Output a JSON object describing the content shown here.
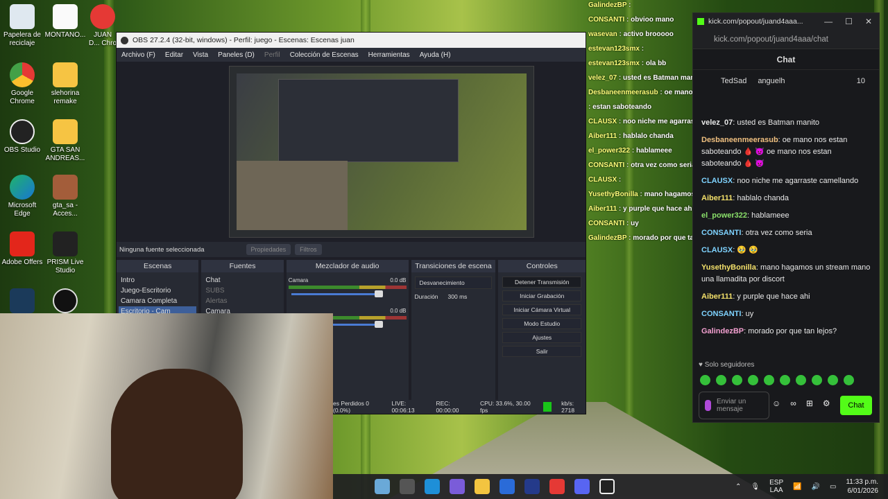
{
  "desktop": {
    "icons": [
      {
        "label": "Papelera de reciclaje"
      },
      {
        "label": "MONTANO..."
      },
      {
        "label": "JUAN D...\nChro"
      },
      {
        "label": "Google Chrome"
      },
      {
        "label": "slehorina remake"
      },
      {
        "label": "OBS Studio"
      },
      {
        "label": "GTA SAN ANDREAS..."
      },
      {
        "label": "Microsoft Edge"
      },
      {
        "label": "gta_sa - Acces..."
      },
      {
        "label": "Adobe Offers"
      },
      {
        "label": "PRISM Live Studio"
      }
    ]
  },
  "obs": {
    "title": "OBS 27.2.4 (32-bit, windows) - Perfil: juego - Escenas: Escenas juan",
    "menu": [
      "Archivo (F)",
      "Editar",
      "Vista",
      "Paneles (D)",
      "Perfil",
      "Colección de Escenas",
      "Herramientas",
      "Ayuda (H)"
    ],
    "no_source": "Ninguna fuente seleccionada",
    "properties_btn": "Propiedades",
    "filters_btn": "Filtros",
    "scenes": {
      "title": "Escenas",
      "items": [
        "Intro",
        "Juego-Escritorio",
        "Camara Completa",
        "Escritorio - Cam"
      ]
    },
    "sources": {
      "title": "Fuentes",
      "items": [
        "Chat",
        "SUBS",
        "Alertas",
        "Camara"
      ]
    },
    "mixer": {
      "title": "Mezclador de audio",
      "tracks": [
        {
          "name": "Camara",
          "db": "0.0 dB"
        },
        {
          "name": "",
          "db": "0.0 dB"
        }
      ]
    },
    "transitions": {
      "title": "Transiciones de escena",
      "type": "Desvanecimiento",
      "duration_label": "Duración",
      "duration": "300 ms"
    },
    "controls": {
      "title": "Controles",
      "buttons": [
        "Detener Transmisión",
        "Iniciar Grabación",
        "Iniciar Cámara Virtual",
        "Modo Estudio",
        "Ajustes",
        "Salir"
      ]
    },
    "status": {
      "dropped": "es Perdidos 0 (0.0%)",
      "live": "LIVE: 00:06:13",
      "rec": "REC: 00:00:00",
      "cpu": "CPU: 33.6%, 30.00 fps",
      "kbs": "kb/s: 2718"
    }
  },
  "overlay_chat": [
    {
      "user": "GalindezBP",
      "text": ""
    },
    {
      "user": "CONSANTI",
      "text": "obvioo mano"
    },
    {
      "user": "wasevan",
      "text": "activo brooooo"
    },
    {
      "user": "estevan123smx",
      "text": ""
    },
    {
      "user": "estevan123smx",
      "text": "ola bb"
    },
    {
      "user": "velez_07",
      "text": "usted es Batman manito"
    },
    {
      "user": "Desbaneenmeerasub",
      "text": "oe mano nos estan saboteando"
    },
    {
      "user": "",
      "text": "estan saboteando"
    },
    {
      "user": "CLAUSX",
      "text": "noo niche me agarraste camellando"
    },
    {
      "user": "Aiber111",
      "text": "hablalo chanda"
    },
    {
      "user": "el_power322",
      "text": "hablameee"
    },
    {
      "user": "CONSANTI",
      "text": "otra vez como seria"
    },
    {
      "user": "CLAUSX",
      "text": ""
    },
    {
      "user": "YusethyBonilla",
      "text": "mano hagamos un stream mano una llamadita por discort"
    },
    {
      "user": "Aiber111",
      "text": "y purple que hace ahi"
    },
    {
      "user": "CONSANTI",
      "text": "uy"
    },
    {
      "user": "GalindezBP",
      "text": "morado por que tan lejos?"
    }
  ],
  "kick": {
    "tab_title": "kick.com/popout/juand4aaa...",
    "url": "kick.com/popout/juand4aaa/chat",
    "header": "Chat",
    "pinned": {
      "user1": "TedSad",
      "user2": "anguelh",
      "count": "10"
    },
    "messages": [
      {
        "user": "velez_07",
        "text": "usted es Batman manito",
        "color": "#e8e8e8"
      },
      {
        "user": "Desbaneenmeerasub",
        "text": "oe mano nos estan saboteando 🩸 👿 oe mano nos estan saboteando 🩸 👿",
        "color": "#f0c080"
      },
      {
        "user": "CLAUSX",
        "text": "noo niche me agarraste camellando",
        "color": "#7fd3ff"
      },
      {
        "user": "Aiber111",
        "text": "hablalo chanda",
        "color": "#f3e06a"
      },
      {
        "user": "el_power322",
        "text": "hablameee",
        "color": "#8ae06a"
      },
      {
        "user": "CONSANTI",
        "text": "otra vez como seria",
        "color": "#7fd3ff"
      },
      {
        "user": "CLAUSX",
        "text": "🥹 🥹",
        "color": "#7fd3ff"
      },
      {
        "user": "YusethyBonilla",
        "text": "mano hagamos un stream mano una llamadita por discort",
        "color": "#f3e06a"
      },
      {
        "user": "Aiber111",
        "text": "y purple que hace ahi",
        "color": "#f3e06a"
      },
      {
        "user": "CONSANTI",
        "text": "uy",
        "color": "#7fd3ff"
      },
      {
        "user": "GalindezBP",
        "text": "morado por que tan lejos?",
        "color": "#f3a0d0"
      }
    ],
    "followers_only": "Solo seguidores",
    "input_placeholder": "Enviar un mensaje",
    "chat_button": "Chat"
  },
  "taskbar": {
    "lang": "ESP\nLAA",
    "time": "11:33 p.m.",
    "date": "6/01/2026"
  },
  "colors": {
    "accent": "#53fc18",
    "obs_bg": "#1e1f27"
  }
}
